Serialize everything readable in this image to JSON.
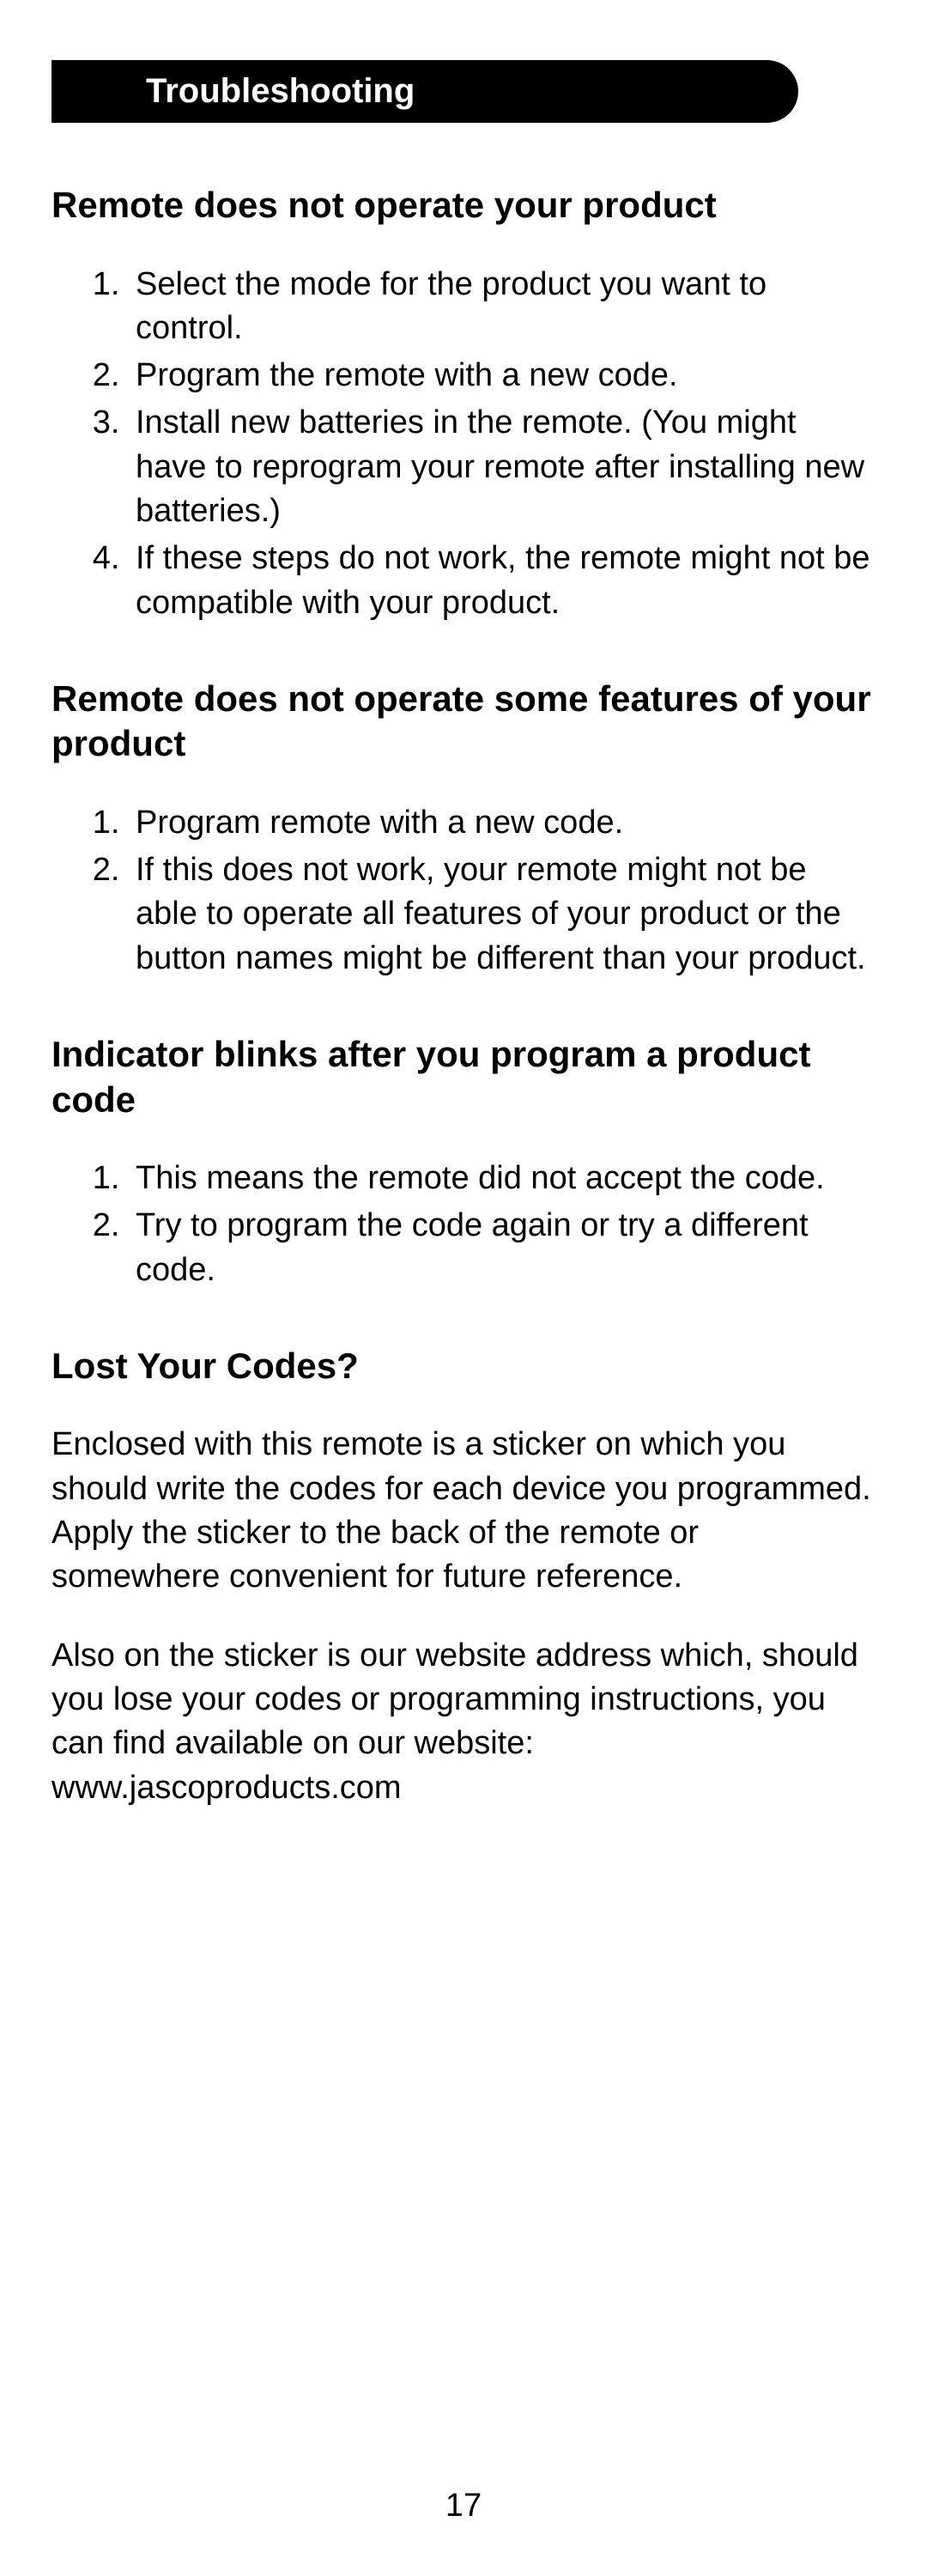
{
  "header": "Troubleshooting",
  "section1": {
    "heading": "Remote does not operate your product",
    "items": [
      "Select the mode for the product you want to control.",
      "Program the remote with a new code.",
      "Install new batteries in the remote. (You might have to reprogram your remote after installing new batteries.)",
      "If these steps do not work, the remote might not be compatible with your product."
    ]
  },
  "section2": {
    "heading": "Remote does not operate some features of your product",
    "items": [
      "Program remote with a new code.",
      "If this does not work, your remote might not be able to operate all features of your product or the button names might be different than your product."
    ]
  },
  "section3": {
    "heading": "Indicator blinks after you program a product code",
    "items": [
      "This means the remote did not accept the code.",
      "Try to program the code again or try a different code."
    ]
  },
  "section4": {
    "heading": "Lost Your Codes?",
    "para1": "Enclosed with this remote is a sticker on which you should write the codes for each device you programmed. Apply the sticker to the back of the remote or somewhere convenient for future reference.",
    "para2": "Also on the sticker is our website address which, should you lose your codes or programming instructions, you can find available on our website: www.jascoproducts.com"
  },
  "page_number": "17"
}
